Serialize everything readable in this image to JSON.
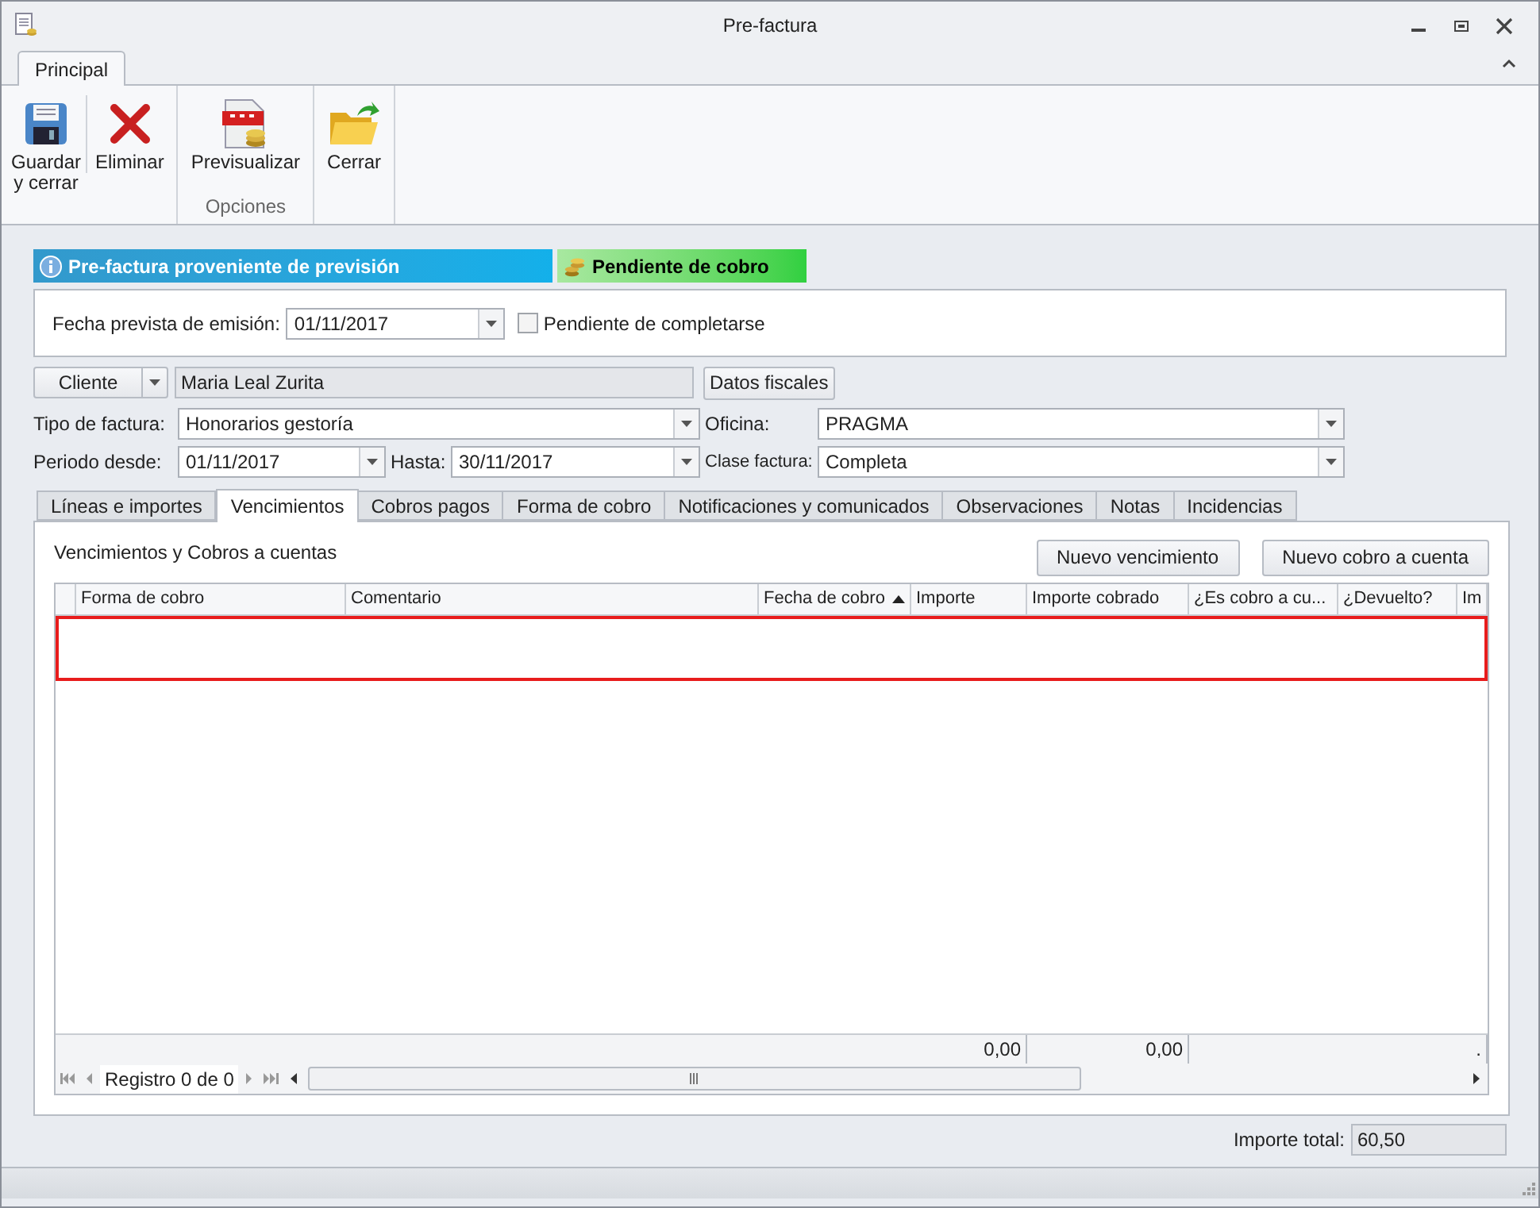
{
  "window": {
    "title": "Pre-factura"
  },
  "ribbon": {
    "tabs": [
      {
        "label": "Principal",
        "selected": true
      }
    ],
    "groups": [
      {
        "buttons": [
          {
            "kind": "save",
            "label": "Guardar y cerrar"
          },
          {
            "kind": "delete",
            "label": "Eliminar"
          }
        ]
      },
      {
        "label": "Opciones",
        "buttons": [
          {
            "kind": "pdf",
            "label": "Previsualizar"
          }
        ]
      },
      {
        "buttons": [
          {
            "kind": "close",
            "label": "Cerrar"
          }
        ]
      }
    ]
  },
  "banners": [
    {
      "kind": "info",
      "text": "Pre-factura proveniente de previsión"
    },
    {
      "kind": "status",
      "text": "Pendiente de cobro"
    }
  ],
  "emission": {
    "label": "Fecha prevista de emisión:",
    "value": "01/11/2017",
    "pending": {
      "label": "Pendiente de completarse",
      "checked": false
    }
  },
  "client": {
    "button": "Cliente",
    "value": "Maria Leal Zurita",
    "fiscal_button": "Datos fiscales"
  },
  "fields": [
    {
      "label": "Tipo de factura:",
      "value": "Honorarios gestoría"
    },
    {
      "label": "Oficina:",
      "value": "PRAGMA"
    },
    {
      "label": "Periodo desde:",
      "value": "01/11/2017"
    },
    {
      "label": "Hasta:",
      "value": "30/11/2017"
    },
    {
      "label": "Clase factura:",
      "value": "Completa"
    }
  ],
  "tabs": [
    {
      "label": "Líneas e importes",
      "selected": false
    },
    {
      "label": "Vencimientos",
      "selected": true
    },
    {
      "label": "Cobros pagos",
      "selected": false
    },
    {
      "label": "Forma de cobro",
      "selected": false
    },
    {
      "label": "Notificaciones y comunicados",
      "selected": false
    },
    {
      "label": "Observaciones",
      "selected": false
    },
    {
      "label": "Notas",
      "selected": false
    },
    {
      "label": "Incidencias",
      "selected": false
    }
  ],
  "panel": {
    "title": "Vencimientos y Cobros a cuentas",
    "buttons": [
      "Nuevo vencimiento",
      "Nuevo cobro a cuenta"
    ]
  },
  "grid": {
    "columns": [
      {
        "label": "Forma de cobro",
        "sorted": false
      },
      {
        "label": "Comentario",
        "sorted": false
      },
      {
        "label": "Fecha de cobro",
        "sorted": true
      },
      {
        "label": "Importe",
        "sorted": false,
        "footer": "0,00"
      },
      {
        "label": "Importe cobrado",
        "sorted": false,
        "footer": "0,00"
      },
      {
        "label": "¿Es cobro a cu...",
        "sorted": false
      },
      {
        "label": "¿Devuelto?",
        "sorted": false
      },
      {
        "label": "Im",
        "sorted": false,
        "footer": "."
      }
    ],
    "navigator": "Registro 0 de 0"
  },
  "total": {
    "label": "Importe total:",
    "value": "60,50"
  }
}
